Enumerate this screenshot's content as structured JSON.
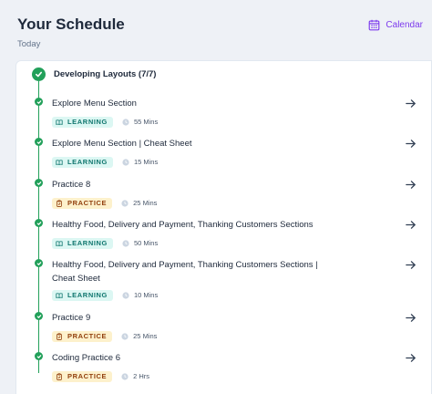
{
  "header": {
    "title": "Your Schedule",
    "calendar_label": "Calendar",
    "subtitle": "Today"
  },
  "group": {
    "title": "Developing Layouts (7/7)"
  },
  "items": [
    {
      "title": "Explore Menu Section",
      "type": "LEARNING",
      "duration": "55 Mins"
    },
    {
      "title": "Explore Menu Section | Cheat Sheet",
      "type": "LEARNING",
      "duration": "15 Mins"
    },
    {
      "title": "Practice 8",
      "type": "PRACTICE",
      "duration": "25 Mins"
    },
    {
      "title": "Healthy Food, Delivery and Payment, Thanking Customers Sections",
      "type": "LEARNING",
      "duration": "50 Mins"
    },
    {
      "title": "Healthy Food, Delivery and Payment, Thanking Customers Sections | Cheat Sheet",
      "type": "LEARNING",
      "duration": "10 Mins"
    },
    {
      "title": "Practice 9",
      "type": "PRACTICE",
      "duration": "25 Mins"
    },
    {
      "title": "Coding Practice 6",
      "type": "PRACTICE",
      "duration": "2 Hrs"
    }
  ],
  "colors": {
    "accent": "#7c3aed",
    "complete": "#22a05a",
    "learning_bg": "#dcf7f3",
    "practice_bg": "#fdf1cc"
  }
}
